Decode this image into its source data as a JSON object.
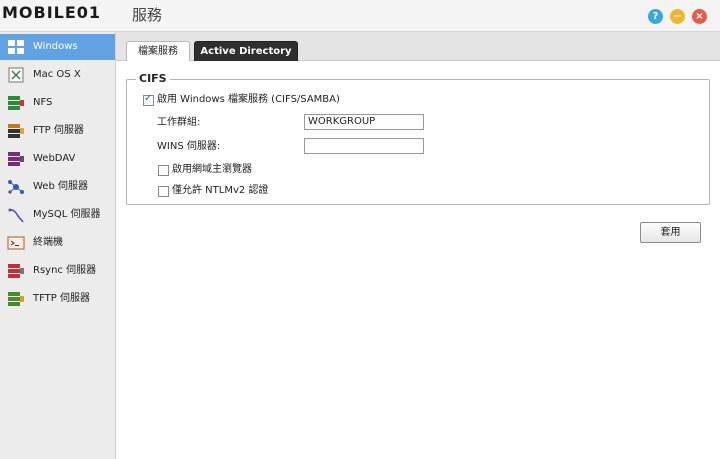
{
  "titlebar": {
    "logo_text": "MOBILE01",
    "window_title": "服務",
    "help_icon": "?",
    "minimize_icon": "−",
    "close_icon": "×"
  },
  "sidebar": {
    "items": [
      {
        "label": "Windows",
        "icon": "windows-icon",
        "active": true
      },
      {
        "label": "Mac OS X",
        "icon": "macos-icon"
      },
      {
        "label": "NFS",
        "icon": "nfs-icon"
      },
      {
        "label": "FTP 伺服器",
        "icon": "ftp-icon"
      },
      {
        "label": "WebDAV",
        "icon": "webdav-icon"
      },
      {
        "label": "Web 伺服器",
        "icon": "web-server-icon"
      },
      {
        "label": "MySQL 伺服器",
        "icon": "mysql-icon"
      },
      {
        "label": "終端機",
        "icon": "terminal-icon"
      },
      {
        "label": "Rsync 伺服器",
        "icon": "rsync-icon"
      },
      {
        "label": "TFTP 伺服器",
        "icon": "tftp-icon"
      }
    ]
  },
  "tabs": [
    {
      "label": "檔案服務",
      "active": true
    },
    {
      "label": "Active Directory",
      "active": false
    }
  ],
  "cifs": {
    "legend": "CIFS",
    "enable_label": "啟用 Windows 檔案服務 (CIFS/SAMBA)",
    "enable_checked": true,
    "workgroup_label": "工作群組:",
    "workgroup_value": "WORKGROUP",
    "wins_label": "WINS 伺服器:",
    "wins_value": "",
    "master_browser_label": "啟用網域主瀏覽器",
    "master_browser_checked": false,
    "ntlmv2_label": "僅允許 NTLMv2 認證",
    "ntlmv2_checked": false
  },
  "apply_label": "套用",
  "colors": {
    "accent": "#63a2e2",
    "help": "#3aa6dc",
    "minimize": "#f1b62f",
    "close": "#e55d4a"
  }
}
